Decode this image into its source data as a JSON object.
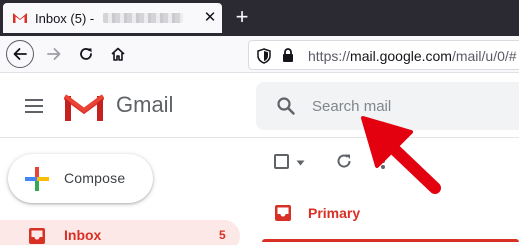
{
  "browser": {
    "tab_title": "Inbox (5) -",
    "tab_close_glyph": "✕",
    "new_tab_glyph": "+",
    "url_scheme": "https://",
    "url_host": "mail.google.com",
    "url_path": "/mail/u/0/#"
  },
  "gmail": {
    "product_name": "Gmail",
    "search_placeholder": "Search mail",
    "compose_label": "Compose",
    "inbox_label": "Inbox",
    "inbox_count": "5",
    "primary_tab_label": "Primary"
  },
  "colors": {
    "gmail_red": "#d93025",
    "annotation_arrow": "#e3000f",
    "tab_strip": "#2b2a33"
  },
  "icons": {
    "menu": "hamburger-icon",
    "search": "magnifier-icon",
    "refresh": "refresh-icon",
    "more": "more-vertical-icon",
    "inbox": "inbox-tray-icon"
  }
}
